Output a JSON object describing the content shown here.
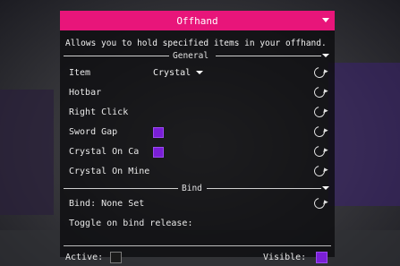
{
  "module": {
    "title": "Offhand",
    "description": "Allows you to hold specified items in your offhand."
  },
  "sections": {
    "general": "General",
    "bind": "Bind"
  },
  "settings": {
    "item": {
      "label": "Item",
      "value": "Crystal"
    },
    "hotbar": {
      "label": "Hotbar"
    },
    "right_click": {
      "label": "Right Click"
    },
    "sword_gap": {
      "label": "Sword Gap",
      "checked": true
    },
    "crystal_on_ca": {
      "label": "Crystal On Ca",
      "checked": true
    },
    "crystal_on_mine": {
      "label": "Crystal On Mine"
    }
  },
  "bind": {
    "label": "Bind: None Set",
    "toggle_release": "Toggle on bind release:"
  },
  "footer": {
    "active_label": "Active:",
    "active": false,
    "visible_label": "Visible:",
    "visible": true
  },
  "colors": {
    "accent": "#e8157a",
    "checkbox_on": "#7a1fd6"
  }
}
